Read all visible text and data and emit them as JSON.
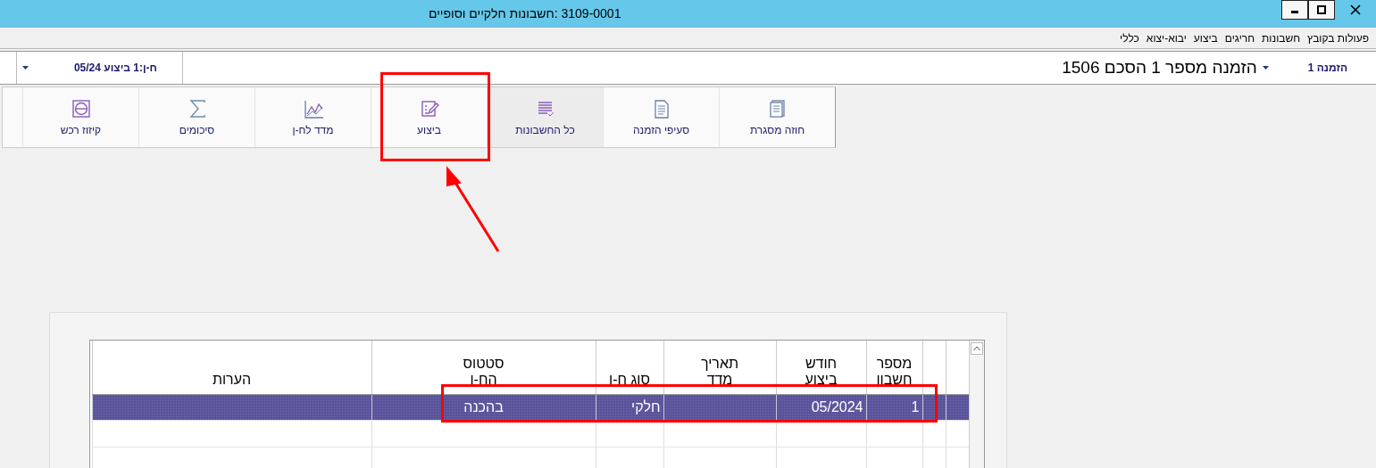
{
  "window": {
    "title": "3109-0001 :חשבונות חלקיים וסופיים"
  },
  "menu": [
    {
      "label": "פעולות בקובץ"
    },
    {
      "label": "חשבונות"
    },
    {
      "label": "חריגים"
    },
    {
      "label": "ביצוע"
    },
    {
      "label": "יבוא-יצוא"
    },
    {
      "label": "כללי"
    }
  ],
  "order_bar": {
    "order_label": "הזמנה 1",
    "order_value": "הזמנה מספר 1 הסכם 1506",
    "invoice_value": "ח-ן:1 ביצוע 05/24"
  },
  "toolbar": [
    {
      "label": "חוזה מסגרת",
      "kind": "notebook",
      "selected": false
    },
    {
      "label": "סעיפי הזמנה",
      "kind": "document",
      "selected": false
    },
    {
      "label": "כל החשבונות",
      "kind": "list",
      "selected": true
    },
    {
      "label": "ביצוע",
      "kind": "edit",
      "selected": false
    },
    {
      "label": "מדד לח-ן",
      "kind": "chart",
      "selected": false
    },
    {
      "label": "סיכומים",
      "kind": "sigma",
      "selected": false
    },
    {
      "label": "קיזוז רכש",
      "kind": "minus",
      "selected": false
    }
  ],
  "table": {
    "columns": [
      {
        "kind": "narrow"
      },
      {
        "kind": "narrow"
      },
      {
        "label": "מספר חשבון",
        "kind": "num"
      },
      {
        "label": "חודש ביצוע",
        "kind": "month"
      },
      {
        "label": "תאריך מדד",
        "kind": "date"
      },
      {
        "label": "סוג ח-ן",
        "kind": "type"
      },
      {
        "label": "סטטוס הח-ן",
        "kind": "status"
      },
      {
        "label": "הערות",
        "kind": "notes"
      }
    ],
    "rows": [
      {
        "selected": true,
        "cells": [
          "",
          "",
          "1",
          "05/2024",
          "",
          "חלקי",
          "בהכנה",
          ""
        ]
      },
      {
        "selected": false,
        "cells": [
          "",
          "",
          "",
          "",
          "",
          "",
          "",
          ""
        ]
      },
      {
        "selected": false,
        "cells": [
          "",
          "",
          "",
          "",
          "",
          "",
          "",
          ""
        ]
      }
    ]
  }
}
